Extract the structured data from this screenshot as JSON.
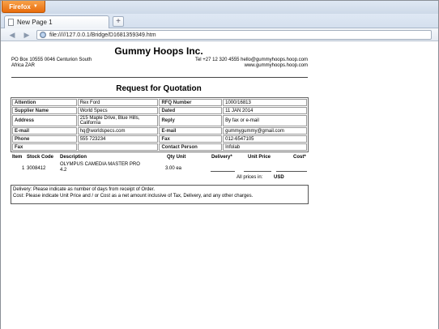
{
  "browser": {
    "menu_button": "Firefox",
    "tab_title": "New Page 1",
    "new_tab_symbol": "+",
    "back_symbol": "◀",
    "forward_symbol": "▶",
    "url": "file://///127.0.0.1/Bridge/D1681359349.htm"
  },
  "document": {
    "company": "Gummy Hoops Inc.",
    "address_left": [
      "PO Box 10555 0046 Centurion South",
      "Africa ZAR"
    ],
    "address_right": [
      "Tel +27 12 320 4555 hello@gummyhoops.hoop.com",
      "www.gummyhoops.hoop.com"
    ],
    "title": "Request for Quotation",
    "info_rows": [
      [
        "Attention",
        "Rex Ford",
        "RFQ Number",
        "1000/16813"
      ],
      [
        "Supplier Name",
        "World Specs",
        "Dated",
        "11 JAN 2014"
      ],
      [
        "Address",
        "215 Maple Drive, Blue Hills, California",
        "Reply",
        "By fax or e-mail"
      ],
      [
        "E-mail",
        "hq@worldspecs.com",
        "E-mail",
        "gummygummy@gmail.com"
      ],
      [
        "Phone",
        "555 723234",
        "Fax",
        "012-6547105"
      ],
      [
        "Fax",
        "",
        "Contact Person",
        "Infolab"
      ]
    ],
    "items_headers": {
      "item": "Item",
      "stock_code": "Stock Code",
      "description": "Description",
      "qty_unit": "Qty Unit",
      "delivery": "Delivery*",
      "unit_price": "Unit Price",
      "cost": "Cost*"
    },
    "item": {
      "item": "1",
      "stock_code": "3008412",
      "description": "OLYMPUS CAMEDIA MASTER PRO 4.2",
      "qty_unit": "3.00 ea"
    },
    "prices_label": "All prices in:",
    "currency": "USD",
    "notes": [
      "Delivery: Please indicate as number of days from receipt of Order.",
      "Cost: Please indicate Unit Price and / or Cost as a net amount inclusive of Tax, Delivery, and any other charges."
    ]
  }
}
